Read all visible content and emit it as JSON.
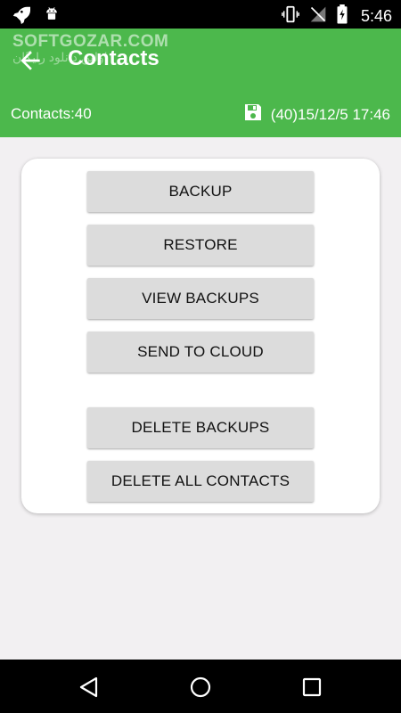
{
  "status_bar": {
    "time": "5:46",
    "icons": [
      "rocket-icon",
      "android-icon",
      "vibrate-icon",
      "no-signal-icon",
      "battery-charging-icon"
    ]
  },
  "app_bar": {
    "watermark": "SOFTGOZAR.COM",
    "watermark_sub": "اولین دانلود رایگان",
    "title": "Contacts",
    "back_icon": "arrow-back-icon",
    "contacts_count": "Contacts:40",
    "save_icon": "floppy-disk-icon",
    "last_backup": "(40)15/12/5 17:46"
  },
  "actions": {
    "backup": "BACKUP",
    "restore": "RESTORE",
    "view_backups": "VIEW BACKUPS",
    "send_to_cloud": "SEND TO CLOUD",
    "delete_backups": "DELETE BACKUPS",
    "delete_all_contacts": "DELETE ALL CONTACTS"
  },
  "nav_bar": {
    "icons": [
      "back-triangle-icon",
      "home-circle-icon",
      "recents-square-icon"
    ]
  },
  "colors": {
    "app_bar": "#4cb84c",
    "background": "#f2f0f2",
    "button": "#dcdcdc"
  }
}
